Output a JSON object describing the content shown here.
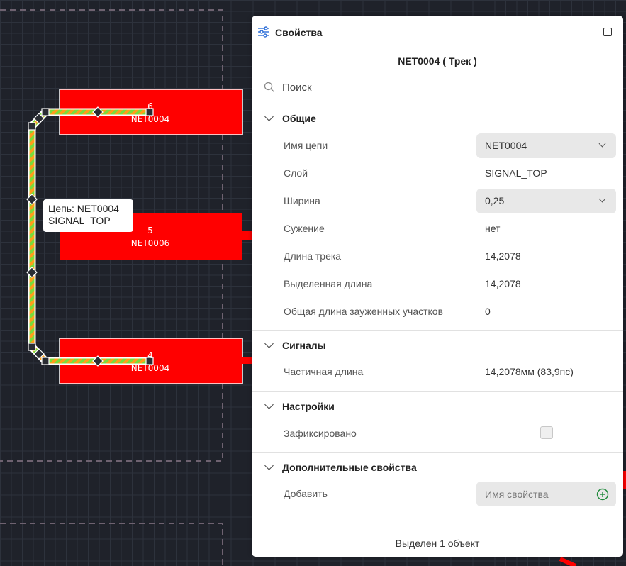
{
  "canvas": {
    "pads": [
      {
        "number": "6",
        "net": "NET0004"
      },
      {
        "number": "5",
        "net": "NET0006"
      },
      {
        "number": "4",
        "net": "NET0004"
      }
    ],
    "tooltip": {
      "line1": "Цепь: NET0004",
      "line2": "SIGNAL_TOP"
    },
    "colors": {
      "pad": "#ff0000",
      "track_a": "#7bdc3a",
      "track_b": "#ff9f1a",
      "background": "#1f222a"
    }
  },
  "panel": {
    "title": "Свойства",
    "subtitle": "NET0004 ( Трек )",
    "search_placeholder": "Поиск",
    "sections": {
      "general": {
        "title": "Общие",
        "rows": {
          "net_name": {
            "label": "Имя цепи",
            "value": "NET0004"
          },
          "layer": {
            "label": "Слой",
            "value": "SIGNAL_TOP"
          },
          "width": {
            "label": "Ширина",
            "value": "0,25"
          },
          "taper": {
            "label": "Сужение",
            "value": "нет"
          },
          "track_length": {
            "label": "Длина трека",
            "value": "14,2078"
          },
          "selected_length": {
            "label": "Выделенная длина",
            "value": "14,2078"
          },
          "total_tapered": {
            "label": "Общая длина зауженных участков",
            "value": "0"
          }
        }
      },
      "signals": {
        "title": "Сигналы",
        "rows": {
          "partial_length": {
            "label": "Частичная длина",
            "value": "14,2078мм (83,9пс)"
          }
        }
      },
      "settings": {
        "title": "Настройки",
        "rows": {
          "locked": {
            "label": "Зафиксировано",
            "checked": false
          }
        }
      },
      "extra": {
        "title": "Дополнительные свойства",
        "rows": {
          "add": {
            "label": "Добавить",
            "placeholder": "Имя свойства"
          }
        }
      }
    },
    "footer": "Выделен 1 объект"
  }
}
